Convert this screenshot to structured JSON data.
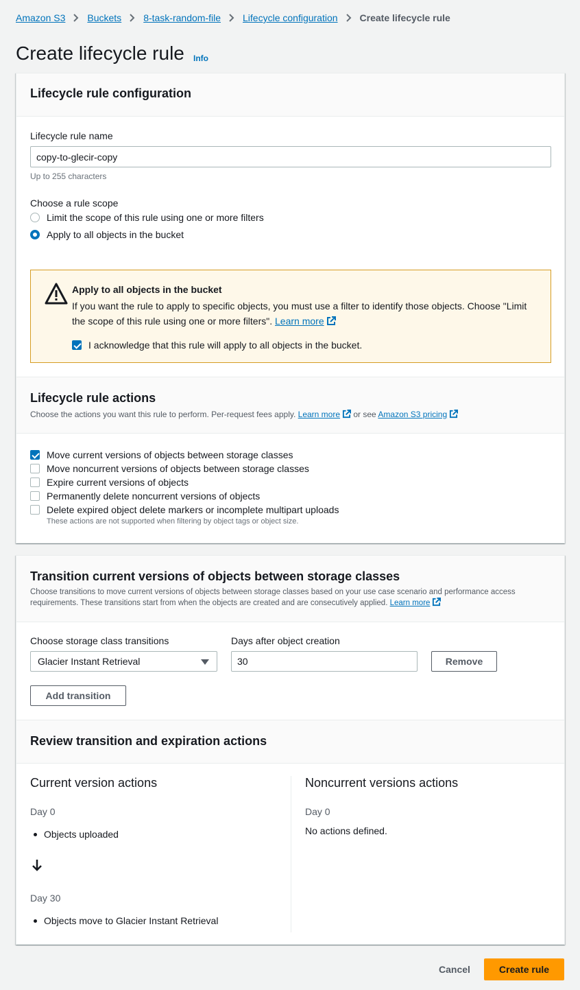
{
  "breadcrumb": {
    "items": [
      "Amazon S3",
      "Buckets",
      "8-task-random-file",
      "Lifecycle configuration"
    ],
    "current": "Create lifecycle rule"
  },
  "page": {
    "title": "Create lifecycle rule",
    "info": "Info"
  },
  "config": {
    "title": "Lifecycle rule configuration",
    "name_label": "Lifecycle rule name",
    "name_value": "copy-to-glecir-copy",
    "name_hint": "Up to 255 characters",
    "scope_label": "Choose a rule scope",
    "scope_options": [
      "Limit the scope of this rule using one or more filters",
      "Apply to all objects in the bucket"
    ],
    "scope_selected": "Apply to all objects in the bucket"
  },
  "alert": {
    "title": "Apply to all objects in the bucket",
    "text": "If you want the rule to apply to specific objects, you must use a filter to identify those objects. Choose \"Limit the scope of this rule using one or more filters\".",
    "learn_more": "Learn more",
    "ack_label": "I acknowledge that this rule will apply to all objects in the bucket.",
    "ack_checked": true
  },
  "actions": {
    "title": "Lifecycle rule actions",
    "desc_prefix": "Choose the actions you want this rule to perform. Per-request fees apply.",
    "learn_more": "Learn more",
    "or_see": "or see",
    "pricing": "Amazon S3 pricing",
    "items": [
      "Move current versions of objects between storage classes",
      "Move noncurrent versions of objects between storage classes",
      "Expire current versions of objects",
      "Permanently delete noncurrent versions of objects",
      "Delete expired object delete markers or incomplete multipart uploads"
    ],
    "checked_item": "Move current versions of objects between storage classes",
    "note": "These actions are not supported when filtering by object tags or object size."
  },
  "transition": {
    "title": "Transition current versions of objects between storage classes",
    "desc_line1": "Choose transitions to move current versions of objects between storage classes based on your use case scenario and performance access",
    "desc_line2": "requirements. These transitions start from when the objects are created and are consecutively applied.",
    "learn_more": "Learn more",
    "class_label": "Choose storage class transitions",
    "class_value": "Glacier Instant Retrieval",
    "days_label": "Days after object creation",
    "days_value": "30",
    "remove": "Remove",
    "add": "Add transition"
  },
  "review": {
    "title": "Review transition and expiration actions",
    "current_title": "Current version actions",
    "current_day0": "Day 0",
    "current_day0_item": "Objects uploaded",
    "current_day30": "Day 30",
    "current_day30_item": "Objects move to Glacier Instant Retrieval",
    "noncurrent_title": "Noncurrent versions actions",
    "noncurrent_day0": "Day 0",
    "noncurrent_empty": "No actions defined."
  },
  "footer": {
    "cancel": "Cancel",
    "create": "Create rule"
  },
  "colors": {
    "link": "#0073bb",
    "primary": "#ff9900",
    "warning_bg": "#fef8e9"
  }
}
